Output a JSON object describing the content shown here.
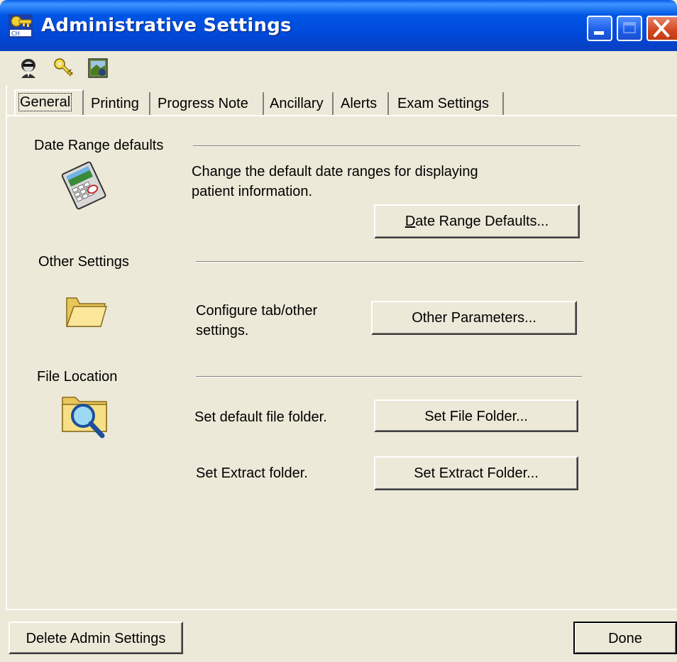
{
  "window": {
    "title": "Administrative Settings",
    "titlebar_color": "#0055E5",
    "controls": [
      "minimize-icon",
      "maximize-icon",
      "close-icon"
    ]
  },
  "toolbar": {
    "icons": [
      "user-agent-icon",
      "key-icon",
      "image-settings-icon"
    ]
  },
  "tabs": [
    {
      "label": "General",
      "active": true
    },
    {
      "label": "Printing",
      "active": false
    },
    {
      "label": "Progress Note",
      "active": false
    },
    {
      "label": "Ancillary",
      "active": false
    },
    {
      "label": "Alerts",
      "active": false
    },
    {
      "label": "Exam Settings",
      "active": false
    }
  ],
  "sections": {
    "date_range": {
      "label": "Date Range defaults",
      "description": "Change the default date ranges for displaying patient information.",
      "button_prefix": "D",
      "button_rest": "ate Range Defaults...",
      "icon": "calendar-calculator-icon"
    },
    "other": {
      "label": "Other Settings",
      "description": "Configure tab/other settings.",
      "button": "Other Parameters...",
      "icon": "folder-icon"
    },
    "file_location": {
      "label": "File Location",
      "icon": "folder-search-icon",
      "file_folder_desc": "Set default file folder.",
      "file_folder_button": "Set File Folder...",
      "extract_desc": "Set Extract folder.",
      "extract_button": "Set Extract Folder..."
    }
  },
  "footer": {
    "delete_button": "Delete Admin Settings",
    "done_button": "Done"
  }
}
